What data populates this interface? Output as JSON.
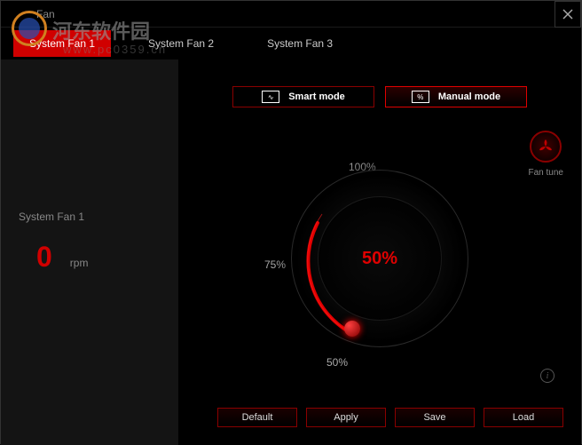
{
  "window": {
    "title": "Fan"
  },
  "watermark": {
    "text": "河东软件园",
    "url": "www.pc0359.cn"
  },
  "tabs": [
    {
      "label": "System Fan 1",
      "active": true
    },
    {
      "label": "System Fan 2",
      "active": false
    },
    {
      "label": "System Fan 3",
      "active": false
    }
  ],
  "sidebar": {
    "fan_label": "System Fan 1",
    "rpm_value": "0",
    "rpm_unit": "rpm"
  },
  "modes": {
    "smart": {
      "label": "Smart mode",
      "icon": "∿"
    },
    "manual": {
      "label": "Manual mode",
      "icon": "%",
      "active": true
    }
  },
  "dial": {
    "value": "50%",
    "ticks": {
      "t100": "100%",
      "t75": "75%",
      "t50": "50%"
    }
  },
  "fan_tune": {
    "label": "Fan tune"
  },
  "buttons": {
    "default": "Default",
    "apply": "Apply",
    "save": "Save",
    "load": "Load"
  },
  "colors": {
    "accent": "#e00000",
    "accent_dark": "#8a0000"
  }
}
